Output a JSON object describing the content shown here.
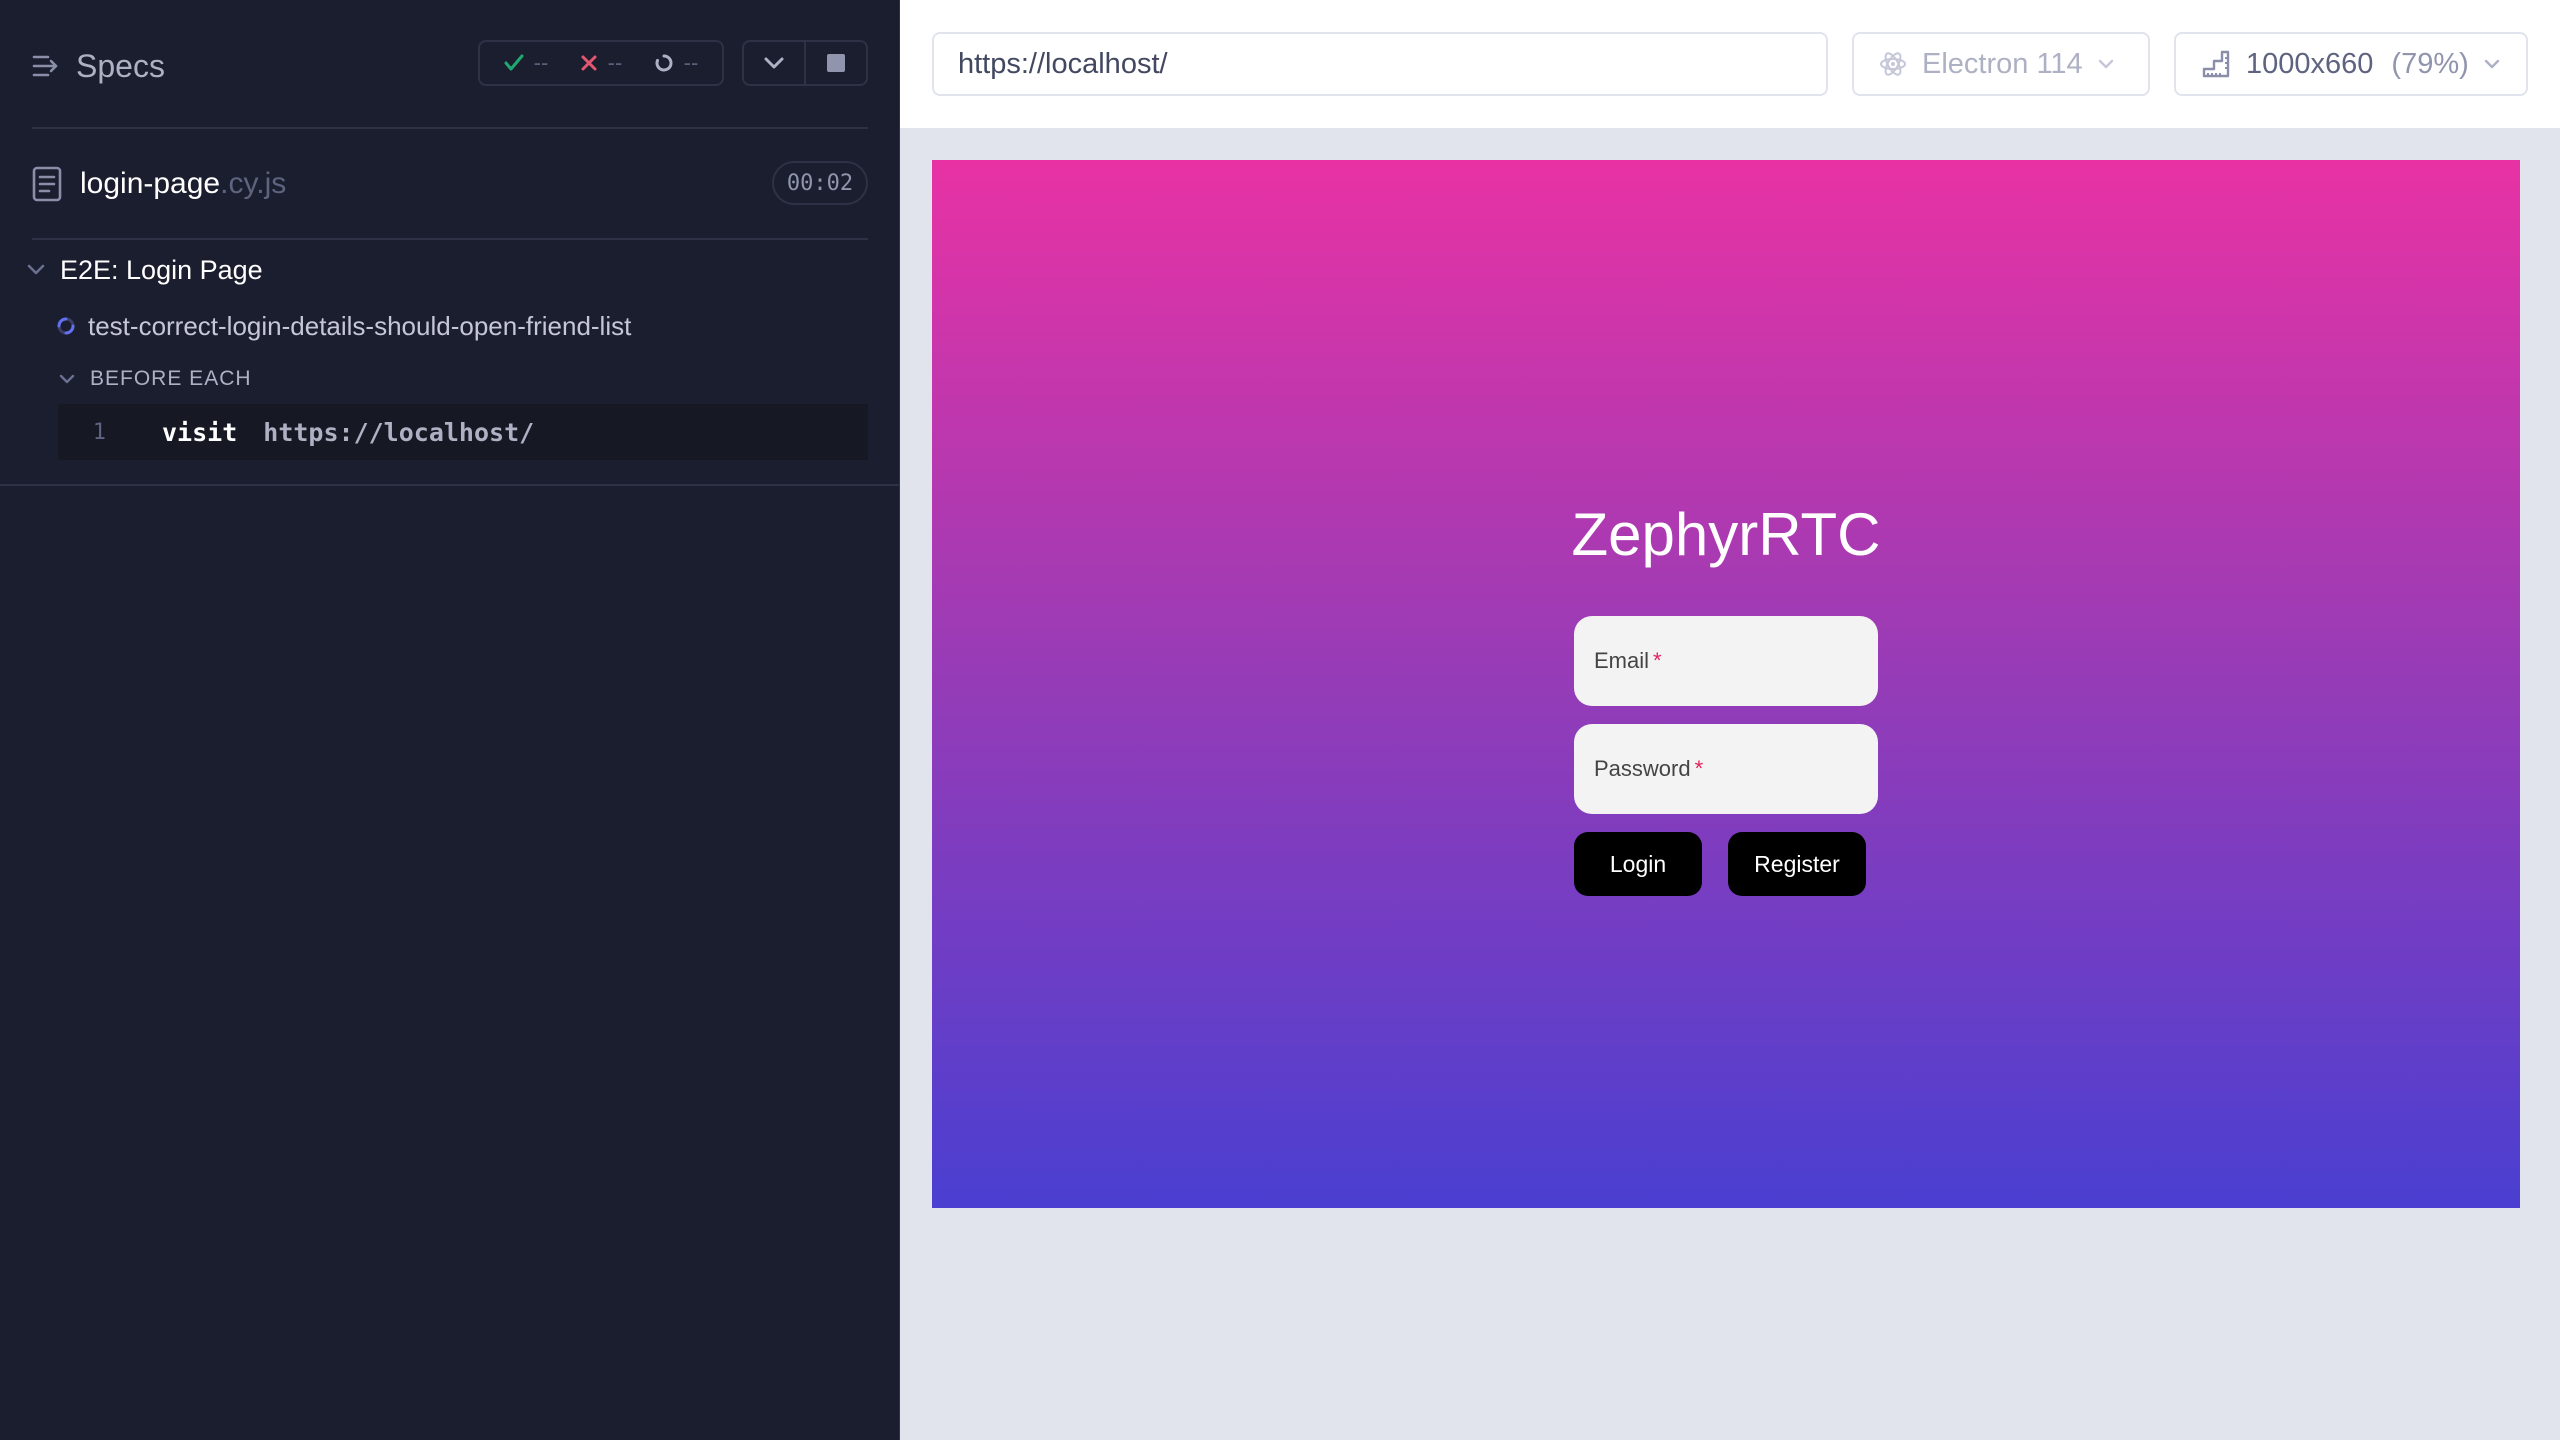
{
  "reporter": {
    "specs_label": "Specs",
    "stats": {
      "passed": "--",
      "failed": "--",
      "pending": "--"
    },
    "spec": {
      "name": "login-page",
      "ext": ".cy.js",
      "duration": "00:02"
    },
    "suite": {
      "title": "E2E: Login Page"
    },
    "test": {
      "title": "test-correct-login-details-should-open-friend-list"
    },
    "hook": {
      "title": "BEFORE EACH"
    },
    "command": {
      "number": "1",
      "name": "visit",
      "message": "https://localhost/"
    }
  },
  "aut": {
    "url": "https://localhost/",
    "browser": "Electron 114",
    "viewport": {
      "size": "1000x660",
      "scale": "(79%)"
    },
    "app": {
      "title": "ZephyrRTC",
      "email_label": "Email",
      "password_label": "Password",
      "required_mark": "*",
      "login_label": "Login",
      "register_label": "Register"
    }
  },
  "colors": {
    "reporter_bg": "#1b1e2e",
    "pass": "#1fa971",
    "fail": "#e45770",
    "running": "#6470f3",
    "gradient_top": "#e832a4",
    "gradient_bottom": "#4a3fd1"
  }
}
